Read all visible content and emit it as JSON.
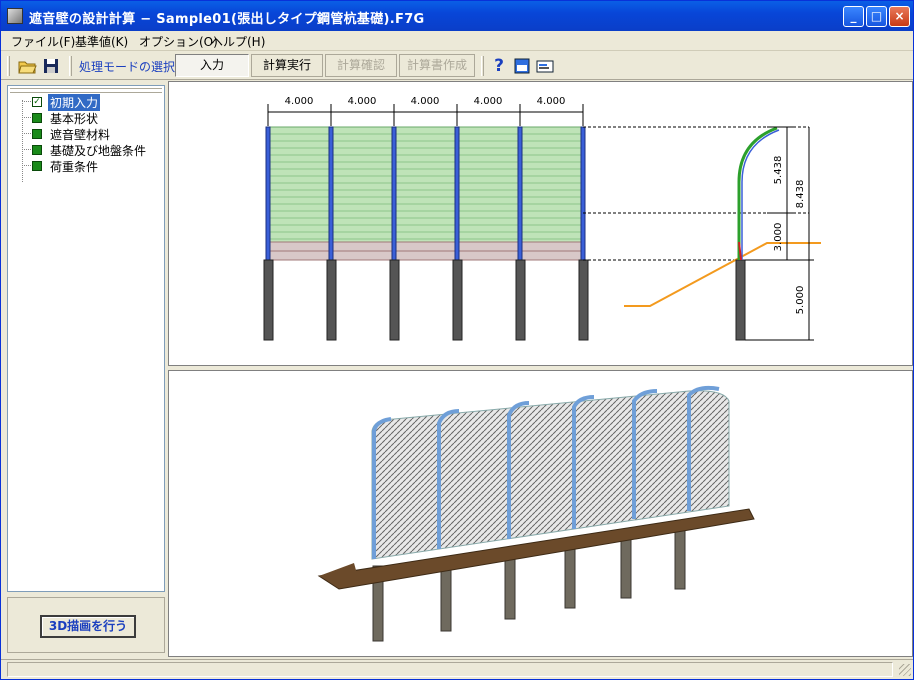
{
  "window": {
    "title": "遮音壁の設計計算 − Sample01(張出しタイプ鋼管杭基礎).F7G",
    "minimize": "_",
    "maximize": "□",
    "close": "×"
  },
  "menu": {
    "file": "ファイル(F)",
    "standard": "基準値(K)",
    "options": "オプション(O)",
    "help": "ヘルプ(H)"
  },
  "toolbar": {
    "mode_label": "処理モードの選択",
    "input": "入力",
    "execute": "計算実行",
    "confirm": "計算確認",
    "report": "計算書作成"
  },
  "tree": {
    "items": [
      {
        "label": "初期入力",
        "checked": true
      },
      {
        "label": "基本形状"
      },
      {
        "label": "遮音壁材料"
      },
      {
        "label": "基礎及び地盤条件"
      },
      {
        "label": "荷重条件"
      }
    ]
  },
  "button_3d": "3D描画を行う",
  "drawing": {
    "spans": [
      "4.000",
      "4.000",
      "4.000",
      "4.000",
      "4.000"
    ],
    "dim_upper": "5.438",
    "dim_total": "8.438",
    "dim_wall": "3.000",
    "dim_pile": "5.000"
  },
  "colors": {
    "panel": "#bfe3b8",
    "post": "#3a5fd8",
    "pile": "#555555",
    "ground": "#f39a1e",
    "deck": "#6b4a2a"
  }
}
